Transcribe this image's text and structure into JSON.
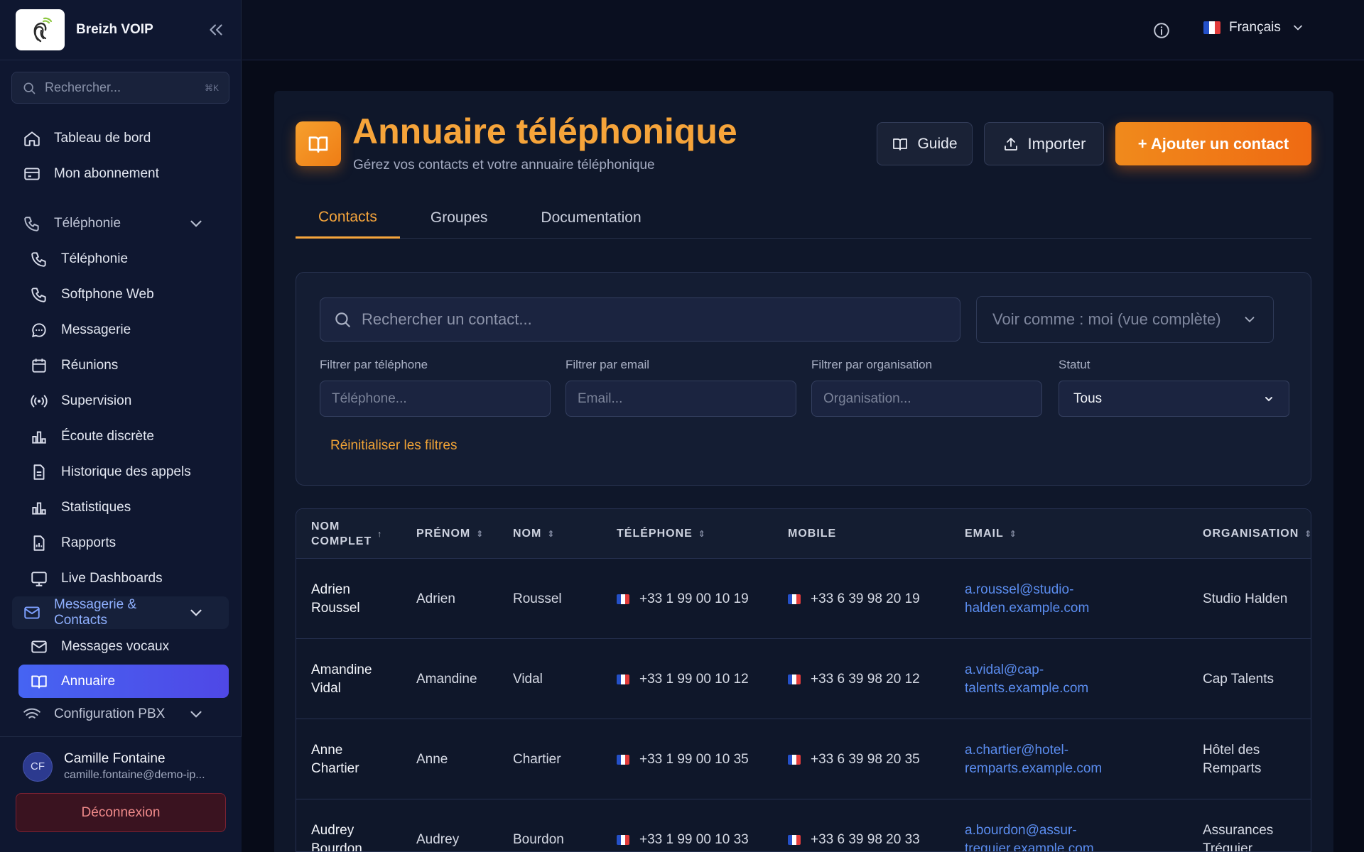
{
  "app": {
    "brand": "Breizh VOIP"
  },
  "sidebar": {
    "search_placeholder": "Rechercher...",
    "search_shortcut": "⌘K",
    "items": [
      {
        "label": "Tableau de bord",
        "icon": "home-icon"
      },
      {
        "label": "Mon abonnement",
        "icon": "card-icon"
      },
      {
        "label": "Téléphonie",
        "icon": "phone-icon",
        "group": true
      },
      {
        "label": "Téléphonie",
        "icon": "phone-icon"
      },
      {
        "label": "Softphone Web",
        "icon": "phone-icon"
      },
      {
        "label": "Messagerie",
        "icon": "chat-icon"
      },
      {
        "label": "Réunions",
        "icon": "calendar-icon"
      },
      {
        "label": "Supervision",
        "icon": "broadcast-icon"
      },
      {
        "label": "Écoute discrète",
        "icon": "bar-chart-icon"
      },
      {
        "label": "Historique des appels",
        "icon": "document-icon"
      },
      {
        "label": "Statistiques",
        "icon": "bar-chart-icon"
      },
      {
        "label": "Rapports",
        "icon": "report-icon"
      },
      {
        "label": "Live Dashboards",
        "icon": "monitor-icon"
      },
      {
        "label": "Messagerie & Contacts",
        "icon": "mail-icon",
        "group": true
      },
      {
        "label": "Messages vocaux",
        "icon": "mail-icon"
      },
      {
        "label": "Annuaire",
        "icon": "book-icon",
        "active": true
      },
      {
        "label": "Configuration PBX",
        "icon": "wifi-icon",
        "group": true
      }
    ]
  },
  "user": {
    "initials": "CF",
    "name": "Camille Fontaine",
    "email": "camille.fontaine@demo-ip...",
    "logout_label": "Déconnexion"
  },
  "topbar": {
    "language": "Français"
  },
  "page": {
    "title": "Annuaire téléphonique",
    "subtitle": "Gérez vos contacts et votre annuaire téléphonique",
    "guide_label": "Guide",
    "import_label": "Importer",
    "add_label": "+ Ajouter un contact",
    "tabs": [
      "Contacts",
      "Groupes",
      "Documentation"
    ]
  },
  "filters": {
    "search_placeholder": "Rechercher un contact...",
    "view_as": "Voir comme : moi (vue complète)",
    "phone_label": "Filtrer par téléphone",
    "phone_placeholder": "Téléphone...",
    "email_label": "Filtrer par email",
    "email_placeholder": "Email...",
    "org_label": "Filtrer par organisation",
    "org_placeholder": "Organisation...",
    "status_label": "Statut",
    "status_value": "Tous",
    "reset_label": "Réinitialiser les filtres"
  },
  "table": {
    "headers": {
      "fullname_1": "NOM",
      "fullname_2": "COMPLET",
      "firstname": "PRÉNOM",
      "lastname": "NOM",
      "phone": "TÉLÉPHONE",
      "mobile": "MOBILE",
      "email": "EMAIL",
      "org": "ORGANISATION"
    },
    "rows": [
      {
        "full1": "Adrien",
        "full2": "Roussel",
        "first": "Adrien",
        "last": "Roussel",
        "phone": "+33 1 99 00 10 19",
        "mobile": "+33 6 39 98 20 19",
        "email1": "a.roussel@studio-",
        "email2": "halden.example.com",
        "org1": "Studio Halden",
        "org2": ""
      },
      {
        "full1": "Amandine",
        "full2": "Vidal",
        "first": "Amandine",
        "last": "Vidal",
        "phone": "+33 1 99 00 10 12",
        "mobile": "+33 6 39 98 20 12",
        "email1": "a.vidal@cap-",
        "email2": "talents.example.com",
        "org1": "Cap Talents",
        "org2": ""
      },
      {
        "full1": "Anne",
        "full2": "Chartier",
        "first": "Anne",
        "last": "Chartier",
        "phone": "+33 1 99 00 10 35",
        "mobile": "+33 6 39 98 20 35",
        "email1": "a.chartier@hotel-",
        "email2": "remparts.example.com",
        "org1": "Hôtel des",
        "org2": "Remparts"
      },
      {
        "full1": "Audrey",
        "full2": "Bourdon",
        "first": "Audrey",
        "last": "Bourdon",
        "phone": "+33 1 99 00 10 33",
        "mobile": "+33 6 39 98 20 33",
        "email1": "a.bourdon@assur-",
        "email2": "treguier.example.com",
        "org1": "Assurances",
        "org2": "Tréguier"
      }
    ]
  }
}
